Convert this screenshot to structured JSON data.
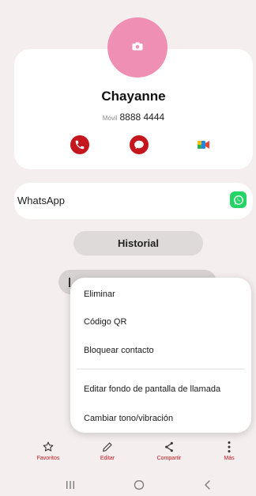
{
  "colors": {
    "accent": "#c4161c",
    "avatar": "#ef8fb4",
    "whatsapp": "#25d366",
    "background": "#f4eeee"
  },
  "contact": {
    "name": "Chayanne",
    "phone_label": "Móvil",
    "phone_number": "8888 4444",
    "avatar_icon": "camera-icon",
    "actions": [
      {
        "icon": "phone-icon"
      },
      {
        "icon": "chat-bubble-icon"
      },
      {
        "icon": "video-call-icon"
      }
    ]
  },
  "linked_apps": [
    {
      "label": "WhatsApp",
      "icon": "whatsapp-icon"
    }
  ],
  "history_button": "Historial",
  "context_menu": {
    "items": [
      "Eliminar",
      "Código QR",
      "Bloquear contacto",
      "Editar fondo de pantalla de llamada",
      "Cambiar tono/vibración"
    ]
  },
  "bottom_bar": [
    {
      "label": "Favoritos",
      "icon": "star-icon"
    },
    {
      "label": "Editar",
      "icon": "pencil-icon"
    },
    {
      "label": "Compartir",
      "icon": "share-icon"
    },
    {
      "label": "Más",
      "icon": "more-vertical-icon"
    }
  ],
  "system_nav": [
    {
      "icon": "recents-icon"
    },
    {
      "icon": "home-icon"
    },
    {
      "icon": "back-icon"
    }
  ]
}
